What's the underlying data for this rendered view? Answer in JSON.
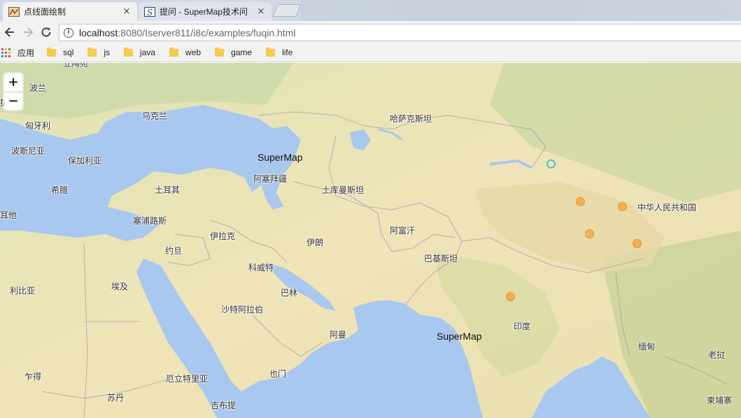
{
  "tabs": [
    {
      "title": "点线面绘制",
      "close": "×",
      "active": true
    },
    {
      "title": "提问 - SuperMap技术问",
      "close": "×",
      "active": false
    }
  ],
  "toolbar": {
    "url_host": "localhost",
    "url_rest": ":8080/Iserver811/i8c/examples/fuqin.html",
    "info_glyph": "i"
  },
  "bookmarks": {
    "apps_label": "应用",
    "folders": [
      "sql",
      "js",
      "java",
      "web",
      "game",
      "life"
    ]
  },
  "map": {
    "zoom_in": "+",
    "zoom_out": "−",
    "supermap_labels": [
      "SuperMap",
      "SuperMap"
    ],
    "places": [
      "波兰",
      "乌克兰",
      "匈牙利",
      "波斯尼亚",
      "保加利亚",
      "希腊",
      "土耳其",
      "塞浦路斯",
      "约旦",
      "伊拉克",
      "阿塞拜疆",
      "土库曼斯坦",
      "哈萨克斯坦",
      "伊朗",
      "阿富汗",
      "巴基斯坦",
      "科威特",
      "巴林",
      "沙特阿拉伯",
      "阿曼",
      "埃及",
      "利比亚",
      "苏丹",
      "乍得",
      "厄立特里亚",
      "吉布提",
      "也门",
      "印度",
      "中华人民共和国",
      "缅甸",
      "老挝",
      "柬埔寨",
      "耳他",
      "捷",
      "立陶宛"
    ],
    "colors": {
      "water": "#a9c8ef",
      "land": "#efe4b8",
      "marker": "#f5a53c",
      "marker_cyan": "#53c3c1"
    }
  }
}
